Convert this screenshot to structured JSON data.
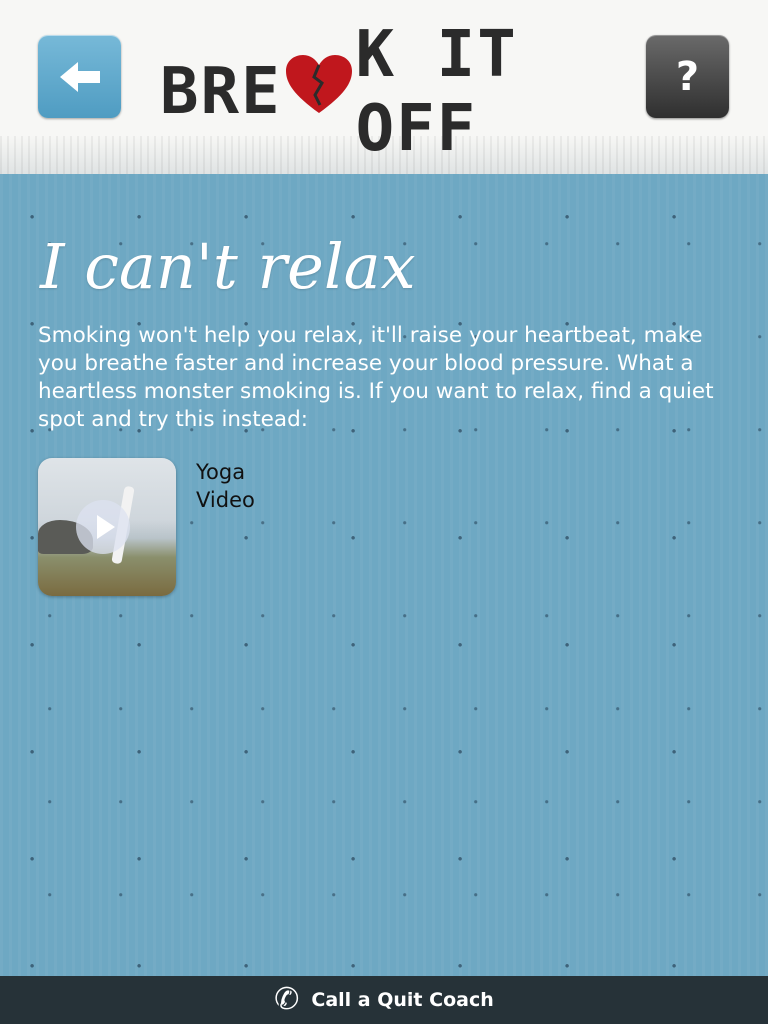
{
  "header": {
    "back_icon": "left-arrow-icon",
    "logo_parts": [
      "BRE",
      "K IT OFF"
    ],
    "logo_heart_icon": "broken-heart-icon",
    "help_label": "?"
  },
  "main": {
    "title": "I can't relax",
    "body": "Smoking won't help you relax, it'll raise your heartbeat, make you breathe faster and increase your blood pressure. What a heartless monster smoking is. If you want to relax, find a quiet spot and try this instead:",
    "video": {
      "label_line1": "Yoga",
      "label_line2": "Video",
      "play_icon": "play-icon"
    }
  },
  "footer": {
    "phone_icon": "phone-icon",
    "label": "Call a Quit Coach"
  },
  "colors": {
    "accent": "#6ea8c3",
    "heart": "#c0171d",
    "footer": "#263238"
  }
}
